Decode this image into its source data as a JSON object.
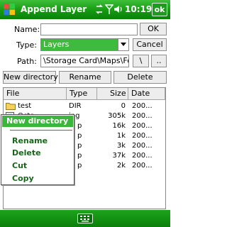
{
  "titlebar": {
    "title": "Append Layer",
    "time": "10:19",
    "ok_label": "ok",
    "icons": [
      "windows-logo-icon",
      "signal-sync-icon",
      "antenna-icon",
      "volume-icon"
    ]
  },
  "form": {
    "name_label": "Name:",
    "name_value": "",
    "ok_button": "OK",
    "type_label": "Type:",
    "type_selected": "Layers",
    "cancel_button": "Cancel",
    "path_label": "Path:",
    "path_value": "\\Storage Card\\Maps\\For",
    "root_button": "\\",
    "up_button": ".."
  },
  "actions": {
    "new_directory": "New directory",
    "rename": "Rename",
    "delete": "Delete"
  },
  "list": {
    "columns": [
      "File",
      "Type",
      "Size",
      "Date"
    ],
    "rows": [
      {
        "file": "test",
        "type": "DIR",
        "size": "0",
        "date": "200..."
      },
      {
        "file": "Octo",
        "type": "jpg",
        "size": "305k",
        "date": "200..."
      },
      {
        "file": "",
        "type": "p",
        "size": "16k",
        "date": "200..."
      },
      {
        "file": "",
        "type": "p",
        "size": "1k",
        "date": "200..."
      },
      {
        "file": "",
        "type": "p",
        "size": "3k",
        "date": "200..."
      },
      {
        "file": "",
        "type": "p",
        "size": "37k",
        "date": "200..."
      },
      {
        "file": "",
        "type": "p",
        "size": "2k",
        "date": "200..."
      }
    ]
  },
  "context_menu": {
    "items": [
      "New directory",
      "Rename",
      "Delete",
      "Cut",
      "Copy"
    ]
  },
  "colors": {
    "accent": "#3bb53b",
    "titlebar": "#159a12"
  }
}
